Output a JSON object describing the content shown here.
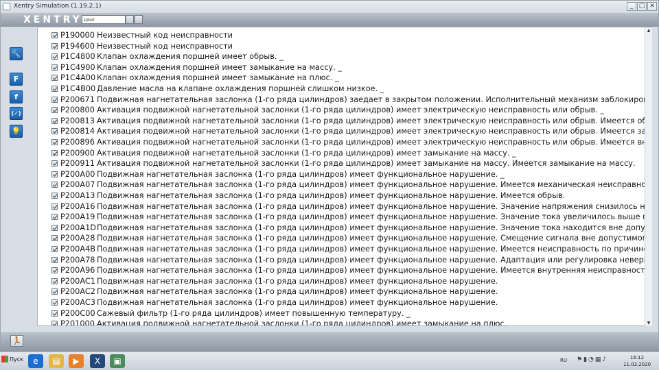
{
  "window": {
    "title": "Xentry Simulation (1.19.2.1)",
    "controls": {
      "minimize": "_",
      "maximize": "□",
      "close": "✕"
    }
  },
  "header": {
    "logo": "XENTRY",
    "input_value": "двиг"
  },
  "sidebar": {
    "buttons": [
      {
        "name": "wrench-icon",
        "glyph": "🔧"
      },
      {
        "name": "f-upper-icon",
        "glyph": "F"
      },
      {
        "name": "f-lower-icon",
        "glyph": "f"
      },
      {
        "name": "check-icon",
        "glyph": "(✓)"
      },
      {
        "name": "bulb-icon",
        "glyph": "💡"
      }
    ]
  },
  "codes": [
    {
      "code": "P190000",
      "text": "Неизвестный код неисправности"
    },
    {
      "code": "P194600",
      "text": "Неизвестный код неисправности"
    },
    {
      "code": "P1C4800",
      "text": "Клапан охлаждения поршней имеет обрыв. _"
    },
    {
      "code": "P1C4900",
      "text": "Клапан охлаждения поршней имеет замыкание на массу. _"
    },
    {
      "code": "P1C4A00",
      "text": "Клапан охлаждения поршней имеет замыкание на плюс. _"
    },
    {
      "code": "P1C4B00",
      "text": "Давление масла на клапане охлаждения поршней слишком низкое. _"
    },
    {
      "code": "P200671",
      "text": "Подвижная нагнетательная заслонка (1-го ряда цилиндров) заедает в закрытом положении. Исполнительный механизм заблокирован."
    },
    {
      "code": "P200800",
      "text": "Активация подвижной нагнетательной заслонки (1-го ряда цилиндров) имеет электрическую неисправность или обрыв. _"
    },
    {
      "code": "P200813",
      "text": "Активация подвижной нагнетательной заслонки (1-го ряда цилиндров) имеет электрическую неисправность или обрыв. Имеется обрыв."
    },
    {
      "code": "P200814",
      "text": "Активация подвижной нагнетательной заслонки (1-го ряда цилиндров) имеет электрическую неисправность или обрыв. Имеется замыкание на"
    },
    {
      "code": "P200896",
      "text": "Активация подвижной нагнетательной заслонки (1-го ряда цилиндров) имеет электрическую неисправность или обрыв. Имеется внутренняя не"
    },
    {
      "code": "P200900",
      "text": "Активация подвижной нагнетательной заслонки (1-го ряда цилиндров) имеет замыкание на массу. _"
    },
    {
      "code": "P200911",
      "text": "Активация подвижной нагнетательной заслонки (1-го ряда цилиндров) имеет замыкание на массу. Имеется замыкание на массу."
    },
    {
      "code": "P200A00",
      "text": "Подвижная нагнетательная заслонка (1-го ряда цилиндров) имеет функциональное нарушение. _"
    },
    {
      "code": "P200A07",
      "text": "Подвижная нагнетательная заслонка (1-го ряда цилиндров) имеет функциональное нарушение. Имеется механическая неисправность."
    },
    {
      "code": "P200A13",
      "text": "Подвижная нагнетательная заслонка (1-го ряда цилиндров) имеет функциональное нарушение. Имеется обрыв."
    },
    {
      "code": "P200A16",
      "text": "Подвижная нагнетательная заслонка (1-го ряда цилиндров) имеет функциональное нарушение. Значение напряжения снизилось ниже гранич"
    },
    {
      "code": "P200A19",
      "text": "Подвижная нагнетательная заслонка (1-го ряда цилиндров) имеет функциональное нарушение. Значение тока увеличилось выше граничного"
    },
    {
      "code": "P200A1D",
      "text": "Подвижная нагнетательная заслонка (1-го ряда цилиндров) имеет функциональное нарушение. Значение тока находится вне допустимого ди"
    },
    {
      "code": "P200A28",
      "text": "Подвижная нагнетательная заслонка (1-го ряда цилиндров) имеет функциональное нарушение. Смещение сигнала вне допустимого диапазон"
    },
    {
      "code": "P200A4B",
      "text": "Подвижная нагнетательная заслонка (1-го ряда цилиндров) имеет функциональное нарушение. Имеется неисправность по причине повышенн"
    },
    {
      "code": "P200A78",
      "text": "Подвижная нагнетательная заслонка (1-го ряда цилиндров) имеет функциональное нарушение. Адаптация или регулировка неверна."
    },
    {
      "code": "P200A96",
      "text": "Подвижная нагнетательная заслонка (1-го ряда цилиндров) имеет функциональное нарушение. Имеется внутренняя неисправность компонент"
    },
    {
      "code": "P200AC1",
      "text": "Подвижная нагнетательная заслонка (1-го ряда цилиндров) имеет функциональное нарушение."
    },
    {
      "code": "P200AC2",
      "text": "Подвижная нагнетательная заслонка (1-го ряда цилиндров) имеет функциональное нарушение."
    },
    {
      "code": "P200AC3",
      "text": "Подвижная нагнетательная заслонка (1-го ряда цилиндров) имеет функциональное нарушение."
    },
    {
      "code": "P200C00",
      "text": "Сажевый фильтр (1-го ряда цилиндров) имеет повышенную температуру. _"
    },
    {
      "code": "P201000",
      "text": "Активация подвижной нагнетательной заслонки (1-го ряда цилиндров) имеет замыкание на плюс."
    }
  ],
  "taskbar": {
    "start_label": "Пуск",
    "language": "RU",
    "time": "16:12",
    "date": "11.03.2020"
  }
}
